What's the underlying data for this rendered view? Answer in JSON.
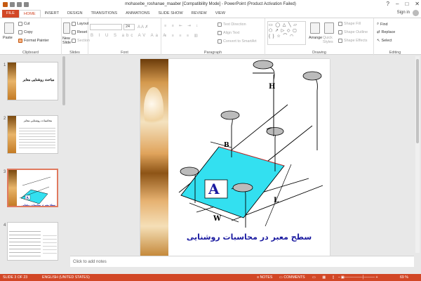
{
  "window": {
    "title": "mohasebe_roshanae_maaber [Compatibility Mode] - PowerPoint (Product Activation Failed)",
    "controls": [
      "?",
      "–",
      "□",
      "✕"
    ]
  },
  "tabs": [
    {
      "label": "FILE",
      "kind": "file"
    },
    {
      "label": "HOME",
      "kind": "active"
    },
    {
      "label": "INSERT"
    },
    {
      "label": "DESIGN"
    },
    {
      "label": "TRANSITIONS"
    },
    {
      "label": "ANIMATIONS"
    },
    {
      "label": "SLIDE SHOW"
    },
    {
      "label": "REVIEW"
    },
    {
      "label": "VIEW"
    }
  ],
  "signin": "Sign in",
  "ribbon": {
    "clipboard": {
      "label": "Clipboard",
      "paste": "Paste",
      "cut": "Cut",
      "copy": "Copy",
      "format_painter": "Format Painter"
    },
    "slides": {
      "label": "Slides",
      "new_slide": "New Slide",
      "layout": "Layout",
      "reset": "Reset",
      "section": "Section"
    },
    "font": {
      "label": "Font",
      "size": "24"
    },
    "paragraph": {
      "label": "Paragraph",
      "text_direction": "Text Direction",
      "align_text": "Align Text",
      "smartart": "Convert to SmartArt"
    },
    "drawing": {
      "label": "Drawing",
      "arrange": "Arrange",
      "quick_styles": "Quick Styles",
      "shape_fill": "Shape Fill",
      "shape_outline": "Shape Outline",
      "shape_effects": "Shape Effects"
    },
    "editing": {
      "label": "Editing",
      "find": "Find",
      "replace": "Replace",
      "select": "Select"
    }
  },
  "thumbnails": [
    {
      "num": "1",
      "title": "مباحث روشنایی معابر"
    },
    {
      "num": "2",
      "title": "محاسبات روشنایی معابر"
    },
    {
      "num": "3",
      "title": "سطح معبر در محاسبات روشنایی"
    },
    {
      "num": "4",
      "title": ""
    }
  ],
  "slide": {
    "labels": {
      "H": "H",
      "B": "B",
      "A": "A",
      "L": "L",
      "W": "W"
    },
    "caption": "سطح معبر در محاسبات روشنایی"
  },
  "notes": {
    "placeholder": "Click to add notes"
  },
  "status": {
    "slide": "SLIDE 3 OF 23",
    "language": "ENGLISH (UNITED STATES)",
    "notes": "NOTES",
    "comments": "COMMENTS",
    "zoom": "69 %"
  },
  "colors": {
    "accent": "#d24726",
    "road": "#33e0f0",
    "caption": "#1a1aa0"
  }
}
